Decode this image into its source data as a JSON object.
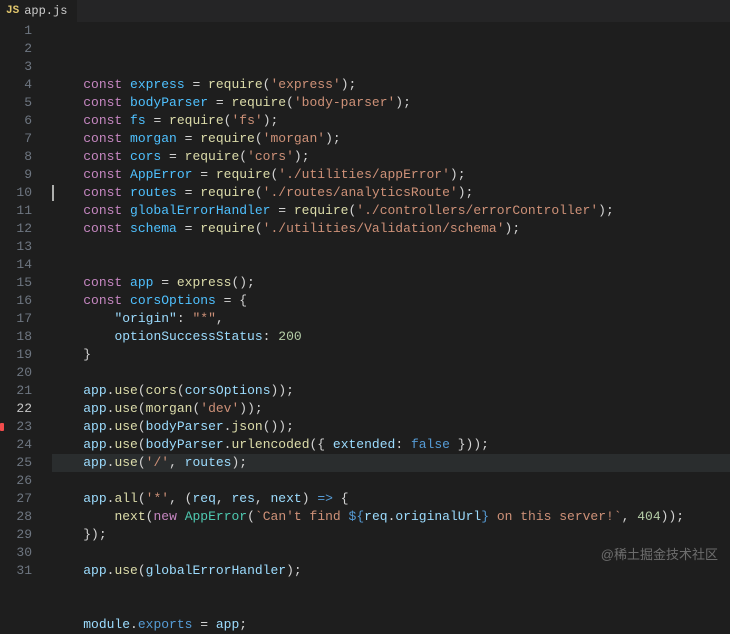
{
  "tab": {
    "icon_label": "JS",
    "filename": "app.js"
  },
  "watermark": "@稀土掘金技术社区",
  "active_line": 22,
  "cursor_line": 10,
  "error_line": 23,
  "lines": [
    {
      "n": 1,
      "tokens": [
        [
          "k",
          "const "
        ],
        [
          "vc",
          "express"
        ],
        [
          "p",
          " = "
        ],
        [
          "fn",
          "require"
        ],
        [
          "p",
          "("
        ],
        [
          "s",
          "'express'"
        ],
        [
          "p",
          ");"
        ]
      ]
    },
    {
      "n": 2,
      "tokens": [
        [
          "k",
          "const "
        ],
        [
          "vc",
          "bodyParser"
        ],
        [
          "p",
          " = "
        ],
        [
          "fn",
          "require"
        ],
        [
          "p",
          "("
        ],
        [
          "s",
          "'body-parser'"
        ],
        [
          "p",
          ");"
        ]
      ]
    },
    {
      "n": 3,
      "tokens": [
        [
          "k",
          "const "
        ],
        [
          "vc",
          "fs"
        ],
        [
          "p",
          " = "
        ],
        [
          "fn",
          "require"
        ],
        [
          "p",
          "("
        ],
        [
          "s",
          "'fs'"
        ],
        [
          "p",
          ");"
        ]
      ]
    },
    {
      "n": 4,
      "tokens": [
        [
          "k",
          "const "
        ],
        [
          "vc",
          "morgan"
        ],
        [
          "p",
          " = "
        ],
        [
          "fn",
          "require"
        ],
        [
          "p",
          "("
        ],
        [
          "s",
          "'morgan'"
        ],
        [
          "p",
          ");"
        ]
      ]
    },
    {
      "n": 5,
      "tokens": [
        [
          "k",
          "const "
        ],
        [
          "vc",
          "cors"
        ],
        [
          "p",
          " = "
        ],
        [
          "fn",
          "require"
        ],
        [
          "p",
          "("
        ],
        [
          "s",
          "'cors'"
        ],
        [
          "p",
          ");"
        ]
      ]
    },
    {
      "n": 6,
      "tokens": [
        [
          "k",
          "const "
        ],
        [
          "vc",
          "AppError"
        ],
        [
          "p",
          " = "
        ],
        [
          "fn",
          "require"
        ],
        [
          "p",
          "("
        ],
        [
          "s",
          "'./utilities/appError'"
        ],
        [
          "p",
          ");"
        ]
      ]
    },
    {
      "n": 7,
      "tokens": [
        [
          "k",
          "const "
        ],
        [
          "vc",
          "routes"
        ],
        [
          "p",
          " = "
        ],
        [
          "fn",
          "require"
        ],
        [
          "p",
          "("
        ],
        [
          "s",
          "'./routes/analyticsRoute'"
        ],
        [
          "p",
          ");"
        ]
      ]
    },
    {
      "n": 8,
      "tokens": [
        [
          "k",
          "const "
        ],
        [
          "vc",
          "globalErrorHandler"
        ],
        [
          "p",
          " = "
        ],
        [
          "fn",
          "require"
        ],
        [
          "p",
          "("
        ],
        [
          "s",
          "'./controllers/errorController'"
        ],
        [
          "p",
          ");"
        ]
      ]
    },
    {
      "n": 9,
      "tokens": [
        [
          "k",
          "const "
        ],
        [
          "vc",
          "schema"
        ],
        [
          "p",
          " = "
        ],
        [
          "fn",
          "require"
        ],
        [
          "p",
          "("
        ],
        [
          "s",
          "'./utilities/Validation/schema'"
        ],
        [
          "p",
          ");"
        ]
      ]
    },
    {
      "n": 10,
      "tokens": []
    },
    {
      "n": 11,
      "tokens": []
    },
    {
      "n": 12,
      "tokens": [
        [
          "k",
          "const "
        ],
        [
          "vc",
          "app"
        ],
        [
          "p",
          " = "
        ],
        [
          "fn",
          "express"
        ],
        [
          "p",
          "();"
        ]
      ]
    },
    {
      "n": 13,
      "tokens": [
        [
          "k",
          "const "
        ],
        [
          "vc",
          "corsOptions"
        ],
        [
          "p",
          " = {"
        ]
      ]
    },
    {
      "n": 14,
      "tokens": [
        [
          "p",
          "    "
        ],
        [
          "pr",
          "\"origin\""
        ],
        [
          "p",
          ": "
        ],
        [
          "s",
          "\"*\""
        ],
        [
          "p",
          ","
        ]
      ]
    },
    {
      "n": 15,
      "tokens": [
        [
          "p",
          "    "
        ],
        [
          "pr",
          "optionSuccessStatus"
        ],
        [
          "p",
          ": "
        ],
        [
          "n",
          "200"
        ]
      ]
    },
    {
      "n": 16,
      "tokens": [
        [
          "p",
          "}"
        ]
      ]
    },
    {
      "n": 17,
      "tokens": []
    },
    {
      "n": 18,
      "tokens": [
        [
          "v",
          "app"
        ],
        [
          "p",
          "."
        ],
        [
          "fn",
          "use"
        ],
        [
          "p",
          "("
        ],
        [
          "fn",
          "cors"
        ],
        [
          "p",
          "("
        ],
        [
          "v",
          "corsOptions"
        ],
        [
          "p",
          "));"
        ]
      ]
    },
    {
      "n": 19,
      "tokens": [
        [
          "v",
          "app"
        ],
        [
          "p",
          "."
        ],
        [
          "fn",
          "use"
        ],
        [
          "p",
          "("
        ],
        [
          "fn",
          "morgan"
        ],
        [
          "p",
          "("
        ],
        [
          "s",
          "'dev'"
        ],
        [
          "p",
          "));"
        ]
      ]
    },
    {
      "n": 20,
      "tokens": [
        [
          "v",
          "app"
        ],
        [
          "p",
          "."
        ],
        [
          "fn",
          "use"
        ],
        [
          "p",
          "("
        ],
        [
          "v",
          "bodyParser"
        ],
        [
          "p",
          "."
        ],
        [
          "fn",
          "json"
        ],
        [
          "p",
          "());"
        ]
      ]
    },
    {
      "n": 21,
      "tokens": [
        [
          "v",
          "app"
        ],
        [
          "p",
          "."
        ],
        [
          "fn",
          "use"
        ],
        [
          "p",
          "("
        ],
        [
          "v",
          "bodyParser"
        ],
        [
          "p",
          "."
        ],
        [
          "fn",
          "urlencoded"
        ],
        [
          "p",
          "({ "
        ],
        [
          "pr",
          "extended"
        ],
        [
          "p",
          ": "
        ],
        [
          "kb",
          "false"
        ],
        [
          "p",
          " }));"
        ]
      ]
    },
    {
      "n": 22,
      "tokens": [
        [
          "v",
          "app"
        ],
        [
          "p",
          "."
        ],
        [
          "fn",
          "use"
        ],
        [
          "p",
          "("
        ],
        [
          "s",
          "'/'"
        ],
        [
          "p",
          ", "
        ],
        [
          "v",
          "routes"
        ],
        [
          "p",
          ");"
        ]
      ]
    },
    {
      "n": 23,
      "tokens": []
    },
    {
      "n": 24,
      "tokens": [
        [
          "v",
          "app"
        ],
        [
          "p",
          "."
        ],
        [
          "fn",
          "all"
        ],
        [
          "p",
          "("
        ],
        [
          "s",
          "'*'"
        ],
        [
          "p",
          ", ("
        ],
        [
          "v",
          "req"
        ],
        [
          "p",
          ", "
        ],
        [
          "v",
          "res"
        ],
        [
          "p",
          ", "
        ],
        [
          "v",
          "next"
        ],
        [
          "p",
          ") "
        ],
        [
          "arrow",
          "=>"
        ],
        [
          "p",
          " {"
        ]
      ]
    },
    {
      "n": 25,
      "tokens": [
        [
          "p",
          "    "
        ],
        [
          "fn",
          "next"
        ],
        [
          "p",
          "("
        ],
        [
          "k",
          "new "
        ],
        [
          "cl",
          "AppError"
        ],
        [
          "p",
          "("
        ],
        [
          "s",
          "`Can't find "
        ],
        [
          "tmpl",
          "${"
        ],
        [
          "v",
          "req"
        ],
        [
          "p",
          "."
        ],
        [
          "v",
          "originalUrl"
        ],
        [
          "tmpl",
          "}"
        ],
        [
          "s",
          " on this server!`"
        ],
        [
          "p",
          ", "
        ],
        [
          "n",
          "404"
        ],
        [
          "p",
          "));"
        ]
      ]
    },
    {
      "n": 26,
      "tokens": [
        [
          "p",
          "});"
        ]
      ]
    },
    {
      "n": 27,
      "tokens": []
    },
    {
      "n": 28,
      "tokens": [
        [
          "v",
          "app"
        ],
        [
          "p",
          "."
        ],
        [
          "fn",
          "use"
        ],
        [
          "p",
          "("
        ],
        [
          "v",
          "globalErrorHandler"
        ],
        [
          "p",
          ");"
        ]
      ]
    },
    {
      "n": 29,
      "tokens": []
    },
    {
      "n": 30,
      "tokens": []
    },
    {
      "n": 31,
      "tokens": [
        [
          "v",
          "module"
        ],
        [
          "p",
          "."
        ],
        [
          "kb",
          "exports"
        ],
        [
          "p",
          " = "
        ],
        [
          "v",
          "app"
        ],
        [
          "p",
          ";"
        ]
      ]
    }
  ]
}
